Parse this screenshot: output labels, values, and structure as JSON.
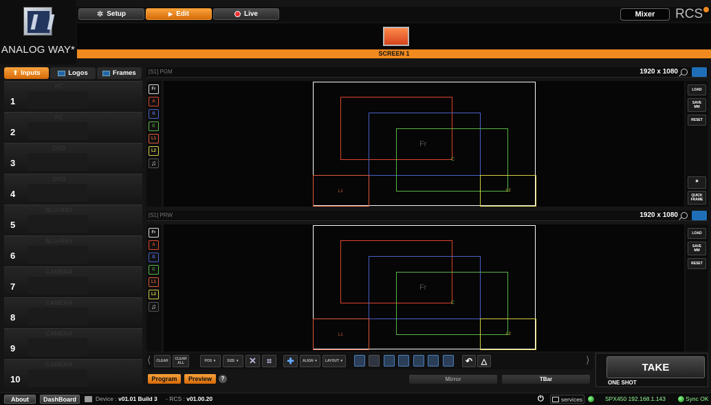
{
  "brand": {
    "logo_text": "ANALOG WAY*",
    "rcs_text": "RCS"
  },
  "top_tabs": [
    {
      "label": "Setup",
      "icon": "gear-icon"
    },
    {
      "label": "Edit",
      "icon": "play-icon"
    },
    {
      "label": "Live",
      "icon": "record-icon"
    }
  ],
  "mixer_label": "Mixer",
  "screen": {
    "label": "SCREEN 1"
  },
  "left_tabs": [
    {
      "label": "Inputs"
    },
    {
      "label": "Logos"
    },
    {
      "label": "Frames"
    }
  ],
  "inputs": [
    {
      "num": "1",
      "name": "PC"
    },
    {
      "num": "2",
      "name": "PC"
    },
    {
      "num": "3",
      "name": "DVD"
    },
    {
      "num": "4",
      "name": "DVD"
    },
    {
      "num": "5",
      "name": "BLU-RAY"
    },
    {
      "num": "6",
      "name": "BLU-RAY"
    },
    {
      "num": "7",
      "name": "CAMERA"
    },
    {
      "num": "8",
      "name": "CAMERA"
    },
    {
      "num": "9",
      "name": "CAMERA"
    },
    {
      "num": "10",
      "name": "CAMERA"
    }
  ],
  "program": {
    "name": "[S1] PGM",
    "resolution": "1920 x 1080"
  },
  "preview": {
    "name": "[S1] PRW",
    "resolution": "1920 x 1080"
  },
  "layer_buttons": [
    "Fr",
    "A",
    "B",
    "C",
    "L1",
    "L2"
  ],
  "layer_colors": {
    "Fr": "#dddddd",
    "A": "#e0452c",
    "B": "#4a62c9",
    "C": "#59b846",
    "L1": "#e05a3a",
    "L2": "#d6cf44",
    "screen": "#ffffff"
  },
  "canvas_labels": {
    "frame": "Fr",
    "c": "C",
    "l1": "L1",
    "l2": "L2"
  },
  "side_buttons": {
    "load": "LOAD",
    "save": "SAVE MM",
    "reset": "RESET",
    "quick": "QUICK FRAME",
    "quick_icon": "*"
  },
  "toolbar": {
    "clear": "CLEAR",
    "clear_all": "CLEAR ALL",
    "pos": "POS ▼",
    "size": "SIZE ▼",
    "align": "ALIGN ▼",
    "layout": "LAYOUT ▼"
  },
  "bottom": {
    "program": "Program",
    "preview": "Preview",
    "help": "?",
    "mirror": "Mirror",
    "tbar": "TBar"
  },
  "take": {
    "label": "TAKE",
    "mode": "ONE SHOT"
  },
  "status": {
    "about": "About",
    "dashboard": "DashBoard",
    "device_prefix": "Device :",
    "device_version": "v01.01 Build 3",
    "rcs_prefix": "- RCS :",
    "rcs_version": "v01.00.20",
    "services": "services",
    "device": "SPX450",
    "ip": "192.168.1.143",
    "sync": "Sync OK"
  }
}
